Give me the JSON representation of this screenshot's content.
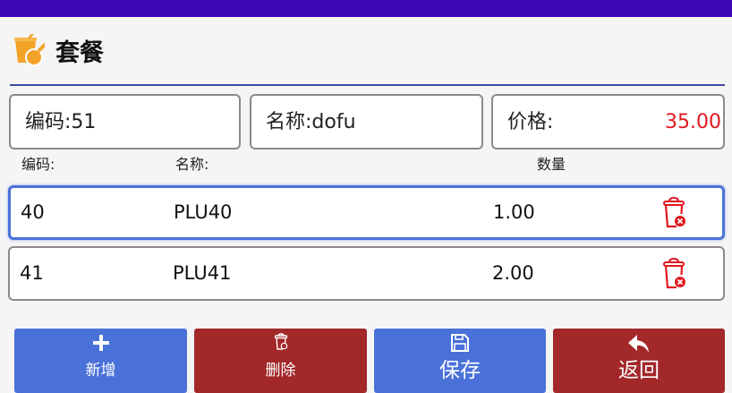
{
  "header": {
    "title": "套餐",
    "logo_icon": "combo-meal-icon"
  },
  "fields": {
    "code": "编码:51",
    "name": "名称:dofu",
    "price_label": "价格:",
    "price_value": "35.00"
  },
  "columns": {
    "code": "编码:",
    "name": "名称:",
    "qty": "数量"
  },
  "rows": [
    {
      "code": "40",
      "name": "PLU40",
      "qty": "1.00",
      "selected": true
    },
    {
      "code": "41",
      "name": "PLU41",
      "qty": "2.00",
      "selected": false
    }
  ],
  "buttons": {
    "add": "新增",
    "delete": "删除",
    "save": "保存",
    "back": "返回"
  },
  "colors": {
    "status_bar": "#3c08b4",
    "primary": "#4a71d8",
    "danger": "#a3282a",
    "price": "#e0191f",
    "trash": "#e0191f",
    "logo": "#f2a227"
  }
}
